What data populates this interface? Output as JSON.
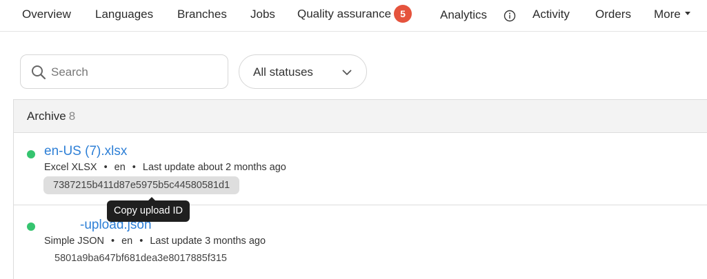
{
  "nav": {
    "items": [
      {
        "label": "Overview"
      },
      {
        "label": "Languages"
      },
      {
        "label": "Branches"
      },
      {
        "label": "Jobs"
      },
      {
        "label": "Quality assurance",
        "badge": "5"
      },
      {
        "label": "Analytics"
      },
      {
        "label": "Activity"
      },
      {
        "label": "Orders"
      },
      {
        "label": "More"
      }
    ]
  },
  "filters": {
    "search_placeholder": "Search",
    "status_value": "All statuses"
  },
  "archive": {
    "title": "Archive",
    "count": "8",
    "files": [
      {
        "name": "en-US (7).xlsx",
        "format": "Excel XLSX",
        "language": "en",
        "updated": "Last update about 2 months ago",
        "upload_id": "7387215b411d87e5975b5c44580581d1",
        "status_color": "#35c46f"
      },
      {
        "name": "-upload.json",
        "format": "Simple JSON",
        "language": "en",
        "updated": "Last update 3 months ago",
        "upload_id": "5801a9ba647bf681dea3e8017885f315",
        "status_color": "#35c46f"
      }
    ]
  },
  "tooltip": {
    "text": "Copy upload ID"
  },
  "colors": {
    "link": "#2d7fd6",
    "badge": "#e5533d",
    "status_ok": "#35c46f"
  }
}
